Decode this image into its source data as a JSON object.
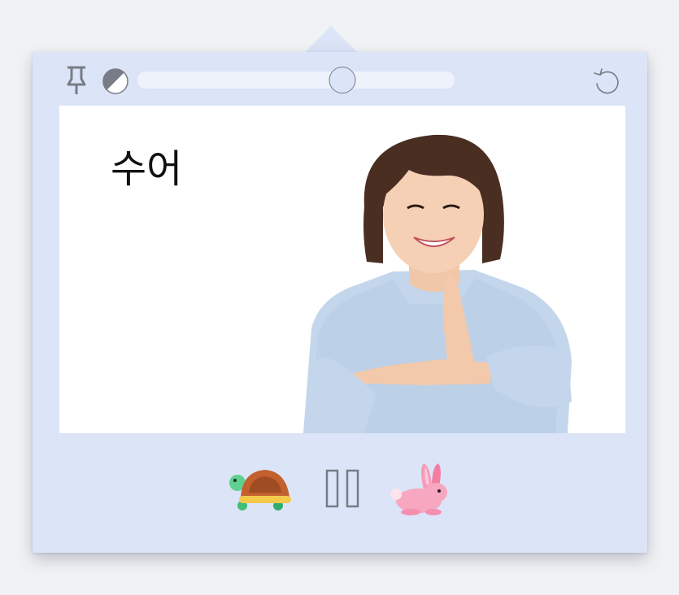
{
  "toolbar": {
    "pin_icon": "pin-icon",
    "contrast_icon": "contrast-icon",
    "size_slider_value": 0.645,
    "reset_icon": "undo-icon"
  },
  "content": {
    "sign_word": "수어",
    "signer_image": "woman-signing-photo"
  },
  "controls": {
    "slow_icon": "turtle-icon",
    "pause_icon": "pause-icon",
    "fast_icon": "rabbit-icon"
  },
  "colors": {
    "page_background": "#f1f2f4",
    "panel_background": "#dce4f7",
    "slider_track": "#eef2fb",
    "icon_stroke": "#777c86"
  }
}
